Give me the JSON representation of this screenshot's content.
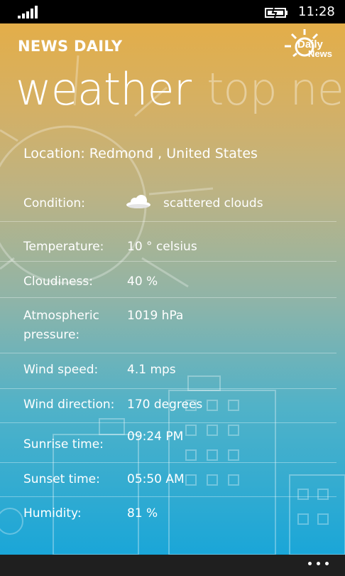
{
  "status": {
    "time": "11:28"
  },
  "app": {
    "name": "NEWS DAILY",
    "logo_line1": "Daily",
    "logo_line2": "News"
  },
  "pivot": {
    "current": "weather",
    "next": "top ne"
  },
  "location": "Location: Redmond , United States",
  "weather": {
    "condition_label": "Condition:",
    "condition_value": "scattered clouds",
    "condition_icon": "cloud-icon",
    "temperature_label": "Temperature:",
    "temperature_value": "10 ° celsius",
    "cloudiness_label": "Cloudiness:",
    "cloudiness_value": "40  %",
    "pressure_label_1": "Atmospheric",
    "pressure_label_2": "pressure:",
    "pressure_value": "1019  hPa",
    "wind_speed_label": "Wind speed:",
    "wind_speed_value": "4.1  mps",
    "wind_dir_label": "Wind direction:",
    "wind_dir_value": "170  degrees",
    "sunrise_label": "Sunrise time:",
    "sunrise_value": "09:24 PM",
    "sunset_label": "Sunset time:",
    "sunset_value": "05:50 AM",
    "humidity_label": "Humidity:",
    "humidity_value": "81  %"
  },
  "colors": {
    "gradient_top": "#e3ae49",
    "gradient_bottom": "#1aa6d8",
    "appbar": "#1f1f1f"
  },
  "appbar": {
    "more_icon": "ellipsis-icon"
  }
}
